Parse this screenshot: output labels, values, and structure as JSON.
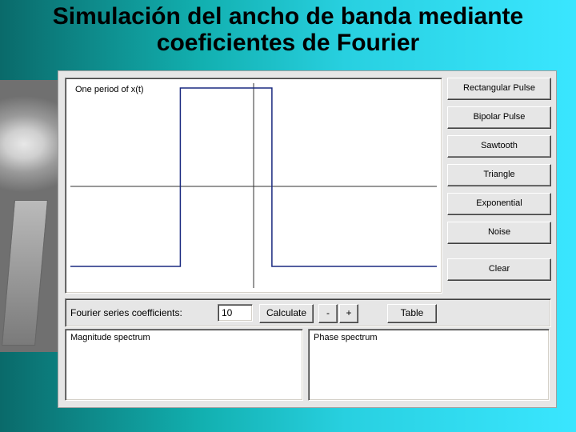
{
  "title": "Simulación del ancho de banda mediante coeficientes de Fourier",
  "plot": {
    "label": "One period of x(t)"
  },
  "waveform_buttons": [
    "Rectangular Pulse",
    "Bipolar Pulse",
    "Sawtooth",
    "Triangle",
    "Exponential",
    "Noise"
  ],
  "clear_button": "Clear",
  "coef": {
    "label": "Fourier series coefficients:",
    "value": "10",
    "calculate": "Calculate",
    "minus": "-",
    "plus": "+",
    "table": "Table"
  },
  "spectra": {
    "magnitude": "Magnitude spectrum",
    "phase": "Phase spectrum"
  },
  "chart_data": {
    "type": "line",
    "title": "One period of x(t)",
    "xlabel": "",
    "ylabel": "",
    "xlim": [
      0,
      1
    ],
    "ylim": [
      0,
      1
    ],
    "x": [
      0,
      0.3,
      0.3,
      0.55,
      0.55,
      1.0
    ],
    "y": [
      0,
      0,
      1,
      1,
      0,
      0
    ]
  }
}
